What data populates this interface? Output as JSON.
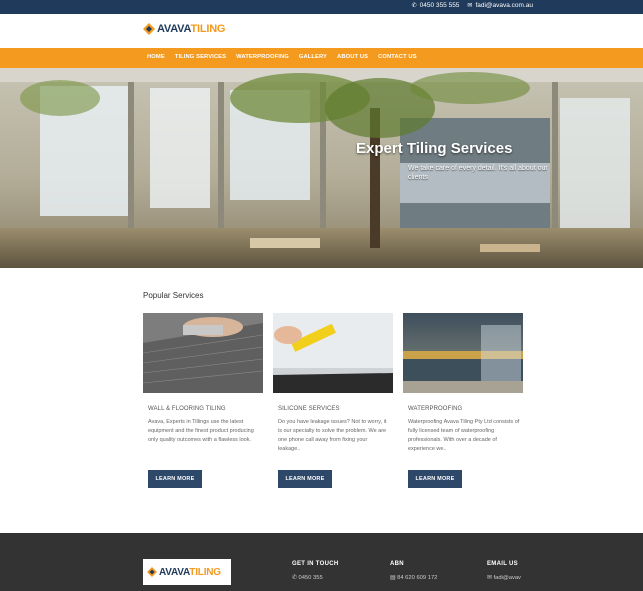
{
  "topbar": {
    "phone": "0450 355 555",
    "email": "fadi@avava.com.au"
  },
  "brand": {
    "name_part1": "AVAVA",
    "name_part2": "TILING"
  },
  "nav": {
    "items": [
      "HOME",
      "TILING SERVICES",
      "WATERPROOFING",
      "GALLERY",
      "ABOUT US",
      "CONTACT US"
    ]
  },
  "hero": {
    "title": "Expert Tiling Services",
    "subtitle": "We take care of every detail. It's all about our clients"
  },
  "services": {
    "heading": "Popular Services",
    "cards": [
      {
        "title": "WALL & FLOORING TILING",
        "description": "Avava, Experts in Tillings use the latest equipment and the finest product producing only quality outcomes with a flawless look.",
        "button": "LEARN MORE"
      },
      {
        "title": "SILICONE SERVICES",
        "description": "Do you have leakage issues? Not to worry, it is our specialty to solve the problem. We are one phone call away from fixing your leakage..",
        "button": "LEARN MORE"
      },
      {
        "title": "WATERPROOFING",
        "description": "Waterproofing Avava Tiling Pty Ltd consists of fully licensed team of waterproofing professionals. With over a decade of experience we..",
        "button": "LEARN MORE"
      }
    ]
  },
  "footer": {
    "get_in_touch": {
      "heading": "GET IN TOUCH",
      "phone": "0450 355"
    },
    "abn": {
      "heading": "ABN",
      "value": "84 620 609 172"
    },
    "email": {
      "heading": "EMAIL US",
      "value": "fadi@avav"
    }
  },
  "colors": {
    "topbar": "#1f3a5a",
    "accent": "#f39a1f",
    "button": "#2d4868",
    "footer": "#333333"
  }
}
